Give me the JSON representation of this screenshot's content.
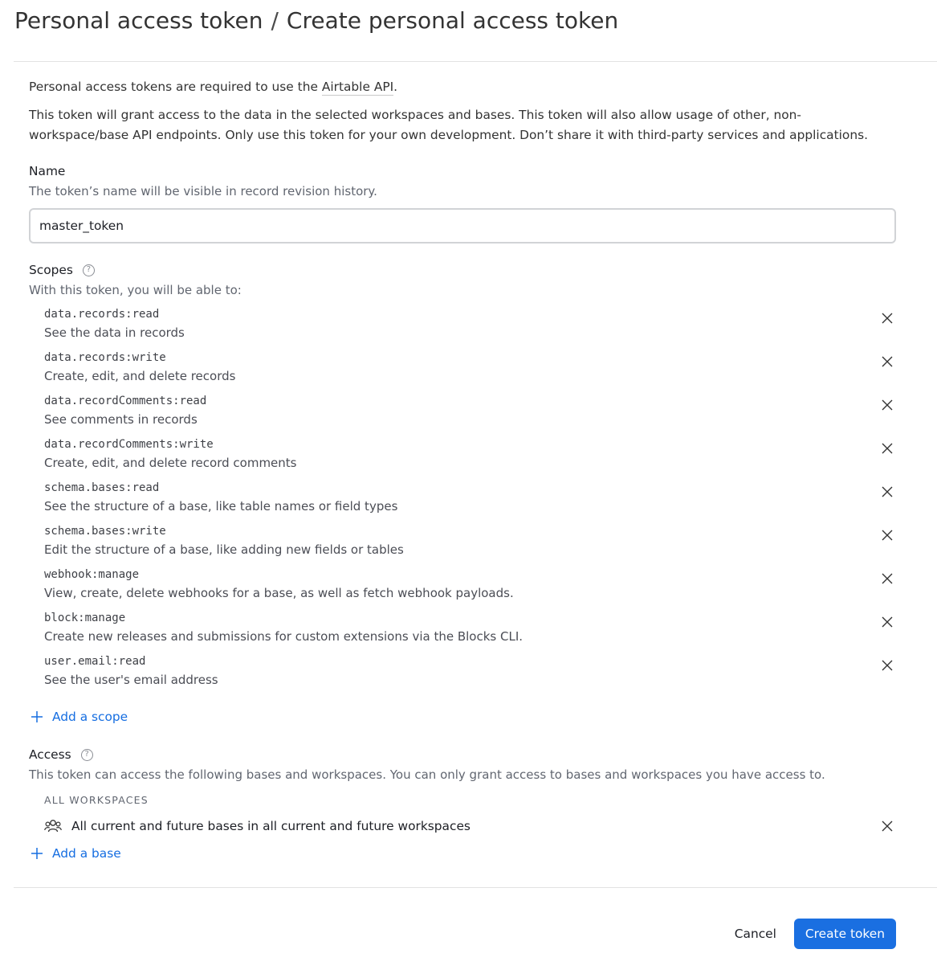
{
  "breadcrumb": {
    "parent": "Personal access token",
    "separator": "/",
    "current": "Create personal access token"
  },
  "intro": {
    "line1_prefix": "Personal access tokens are required to use the ",
    "api_link": "Airtable API",
    "line1_suffix": ".",
    "line2": "This token will grant access to the data in the selected workspaces and bases. This token will also allow usage of other, non-workspace/base API endpoints. Only use this token for your own development. Don’t share it with third-party services and applications."
  },
  "name": {
    "label": "Name",
    "help": "The token’s name will be visible in record revision history.",
    "value": "master_token"
  },
  "scopes": {
    "label": "Scopes",
    "help_icon": "question-icon",
    "help": "With this token, you will be able to:",
    "items": [
      {
        "code": "data.records:read",
        "desc": "See the data in records"
      },
      {
        "code": "data.records:write",
        "desc": "Create, edit, and delete records"
      },
      {
        "code": "data.recordComments:read",
        "desc": "See comments in records"
      },
      {
        "code": "data.recordComments:write",
        "desc": "Create, edit, and delete record comments"
      },
      {
        "code": "schema.bases:read",
        "desc": "See the structure of a base, like table names or field types"
      },
      {
        "code": "schema.bases:write",
        "desc": "Edit the structure of a base, like adding new fields or tables"
      },
      {
        "code": "webhook:manage",
        "desc": "View, create, delete webhooks for a base, as well as fetch webhook payloads."
      },
      {
        "code": "block:manage",
        "desc": "Create new releases and submissions for custom extensions via the Blocks CLI."
      },
      {
        "code": "user.email:read",
        "desc": "See the user's email address"
      }
    ],
    "add_label": "Add a scope"
  },
  "access": {
    "label": "Access",
    "help_icon": "question-icon",
    "help": "This token can access the following bases and workspaces. You can only grant access to bases and workspaces you have access to.",
    "group_heading": "ALL WORKSPACES",
    "item_text": "All current and future bases in all current and future workspaces",
    "item_icon": "people-icon",
    "add_label": "Add a base"
  },
  "footer": {
    "cancel_label": "Cancel",
    "create_label": "Create token"
  },
  "colors": {
    "accent": "#1a6fe1",
    "link": "#166ee1"
  }
}
